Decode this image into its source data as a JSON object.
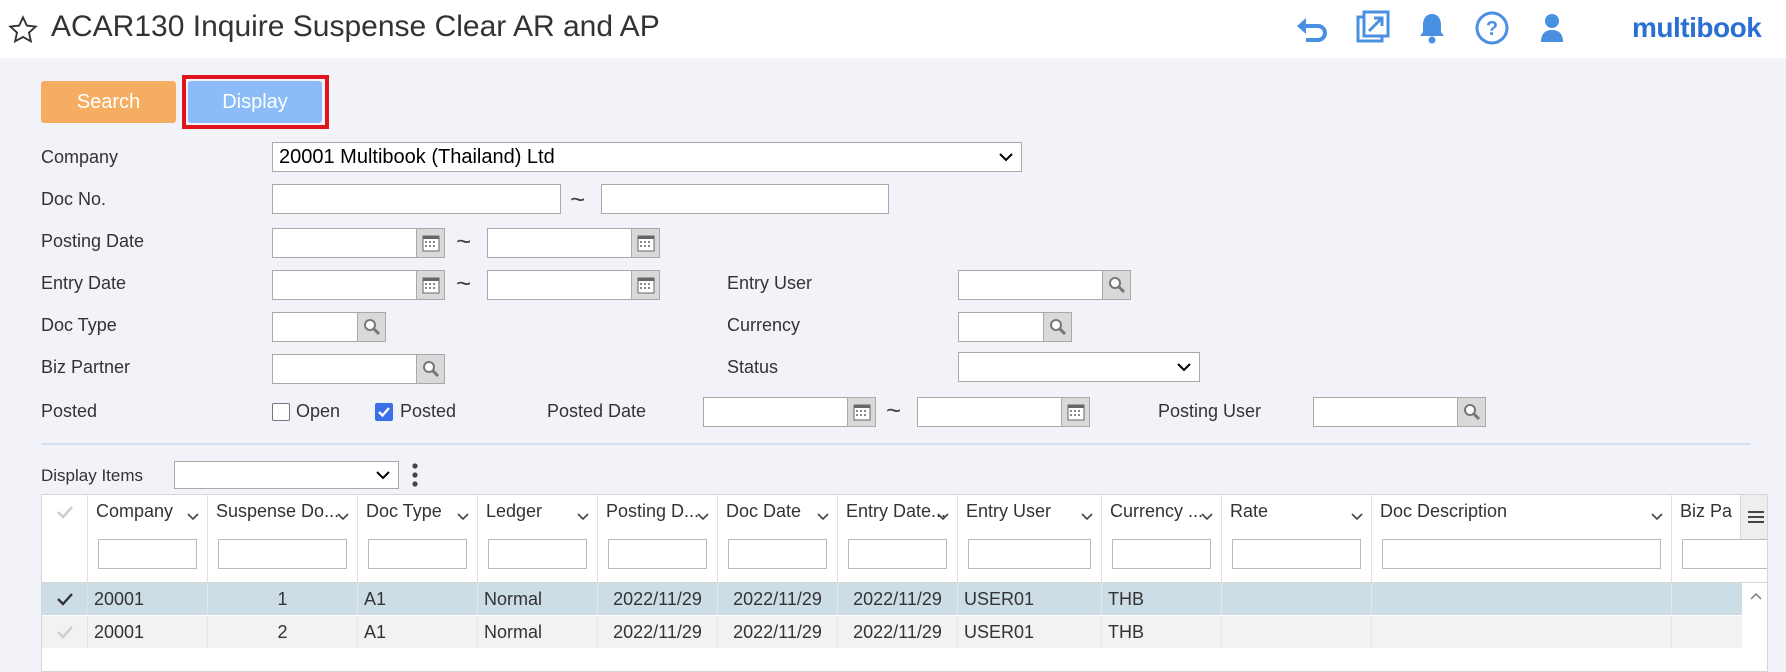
{
  "header": {
    "title": "ACAR130 Inquire Suspense Clear AR and AP",
    "logo": "multibook",
    "icons": [
      "star-icon",
      "undo-icon",
      "popout-icon",
      "bell-icon",
      "help-icon",
      "user-icon"
    ],
    "accent": "#2a6fd1"
  },
  "actions": {
    "search_label": "Search",
    "display_label": "Display"
  },
  "form": {
    "company_label": "Company",
    "company_value": "20001 Multibook (Thailand) Ltd",
    "doc_no_label": "Doc No.",
    "posting_date_label": "Posting Date",
    "entry_date_label": "Entry Date",
    "entry_user_label": "Entry User",
    "doc_type_label": "Doc Type",
    "currency_label": "Currency",
    "biz_partner_label": "Biz Partner",
    "status_label": "Status",
    "posted_label": "Posted",
    "open_label": "Open",
    "open_checked": false,
    "posted_option_label": "Posted",
    "posted_checked": true,
    "posted_date_label": "Posted Date",
    "posting_user_label": "Posting User",
    "range_sep": "~"
  },
  "display_items": {
    "label": "Display Items"
  },
  "grid": {
    "columns": [
      "Company",
      "Suspense Do...",
      "Doc Type",
      "Ledger",
      "Posting D...",
      "Doc Date",
      "Entry Date...",
      "Entry User",
      "Currency ...",
      "Rate",
      "Doc Description",
      "Biz Pa"
    ],
    "rows": [
      {
        "cells": [
          "20001",
          "1",
          "A1",
          "Normal",
          "2022/11/29",
          "2022/11/29",
          "2022/11/29",
          "USER01",
          "THB",
          "",
          "",
          ""
        ],
        "selected": true
      },
      {
        "cells": [
          "20001",
          "2",
          "A1",
          "Normal",
          "2022/11/29",
          "2022/11/29",
          "2022/11/29",
          "USER01",
          "THB",
          "",
          "",
          ""
        ],
        "selected": false
      }
    ],
    "selected_row_color": "#cddde6"
  }
}
